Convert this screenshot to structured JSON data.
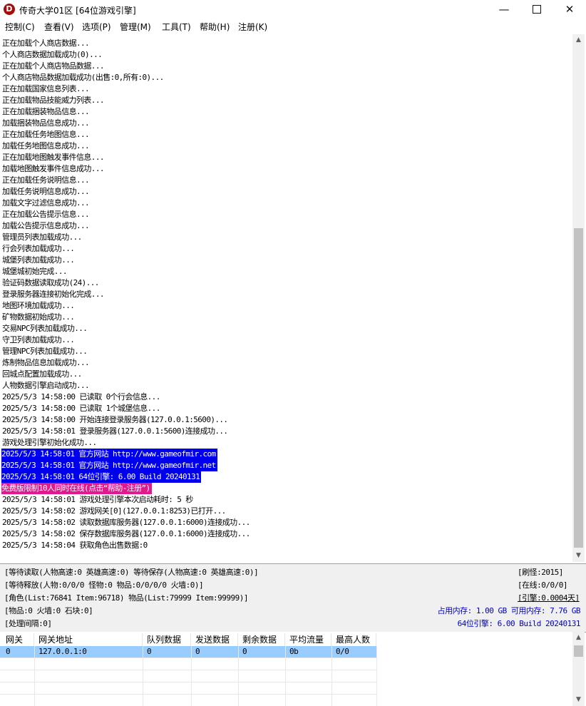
{
  "window": {
    "icon_letter": "D",
    "title": "传奇大学01区 [64位游戏引擎]",
    "controls": {
      "minimize": "—",
      "close": "✕"
    }
  },
  "menu": [
    "控制(C)",
    "查看(V)",
    "选项(P)",
    "管理(M)",
    "工具(T)",
    "帮助(H)",
    "注册(K)"
  ],
  "log_lines": [
    "正在加载个人商店数据...",
    "个人商店数据加载成功(0)...",
    "正在加载个人商店物品数据...",
    "个人商店物品数据加载成功(出售:0,所有:0)...",
    "正在加载国家信息列表...",
    "正在加载物品技能威力列表...",
    "正在加载捆装物品信息...",
    "加载捆装物品信息成功...",
    "正在加载任务地图信息...",
    "加载任务地图信息成功...",
    "正在加载地图触发事件信息...",
    "加载地图触发事件信息成功...",
    "正在加载任务说明信息...",
    "加载任务说明信息成功...",
    "加载文字过滤信息成功...",
    "正在加载公告提示信息...",
    "加载公告提示信息成功...",
    "管理员列表加载成功...",
    "行会列表加载成功...",
    "城堡列表加载成功...",
    "城堡城初始完成...",
    "验证码数据读取成功(24)...",
    "登录服务器连接初始化完成...",
    "地图环境加载成功...",
    "矿物数据初始成功...",
    "交易NPC列表加载成功...",
    "守卫列表加载成功...",
    "管理NPC列表加载成功...",
    "炼制物品信息加载成功...",
    "回城点配置加载成功...",
    "人物数据引擎启动成功...",
    "2025/5/3 14:58:00 已读取 0个行会信息...",
    "2025/5/3 14:58:00 已读取 1个城堡信息...",
    "2025/5/3 14:58:00 开始连接登录服务器(127.0.0.1:5600)...",
    "2025/5/3 14:58:01 登录服务器(127.0.0.1:5600)连接成功...",
    "游戏处理引擎初始化成功...",
    "2025/5/3 14:58:01 官方网站 http://www.gameofmir.com",
    "2025/5/3 14:58:01 官方网站 http://www.gameofmir.net",
    "2025/5/3 14:58:01 64位引擎: 6.00 Build 20240131",
    "免费版限制10人同时在线(点击“帮助-注册”)",
    "2025/5/3 14:58:01 游戏处理引擎本次启动耗时: 5 秒",
    "2025/5/3 14:58:02 游戏网关[0](127.0.0.1:8253)已打开...",
    "2025/5/3 14:58:02 读取数据库服务器(127.0.0.1:6000)连接成功...",
    "2025/5/3 14:58:02 保存数据库服务器(127.0.0.1:6000)连接成功...",
    "2025/5/3 14:58:04 获取角色出售数据:0"
  ],
  "highlight": {
    "blue": "#0000ee",
    "pink": "#e01a8e",
    "blue_lines": [
      36,
      37,
      38
    ],
    "pink_lines": [
      39
    ]
  },
  "status": {
    "line1_left": "[等待读取(人物高速:0 英雄高速:0) 等待保存(人物高速:0 英雄高速:0)]",
    "line1_right": "[刷怪:2015]",
    "line2_left": "[等待释放(人物:0/0/0 怪物:0 物品:0/0/0/0 火墙:0)]",
    "line2_right": "[在线:0/0/0]",
    "line3_left": "[角色(List:76841 Item:96718) 物品(List:79999 Item:99999)]",
    "line3_right": "[引擎:0.0004天]",
    "line4_left": "[物品:0 火墙:0 石块:0]",
    "line4_right": "占用内存: 1.00 GB 可用内存: 7.76 GB",
    "line5_left": "[处理间隔:0]",
    "line5_right": "64位引擎: 6.00 Build 20240131"
  },
  "gateway_table": {
    "headers": [
      "网关",
      "网关地址",
      "队列数据",
      "发送数据",
      "剩余数据",
      "平均流量",
      "最高人数"
    ],
    "rows": [
      [
        "0",
        "127.0.0.1:0",
        "0",
        "0",
        "0",
        "0b",
        "0/0"
      ]
    ]
  }
}
